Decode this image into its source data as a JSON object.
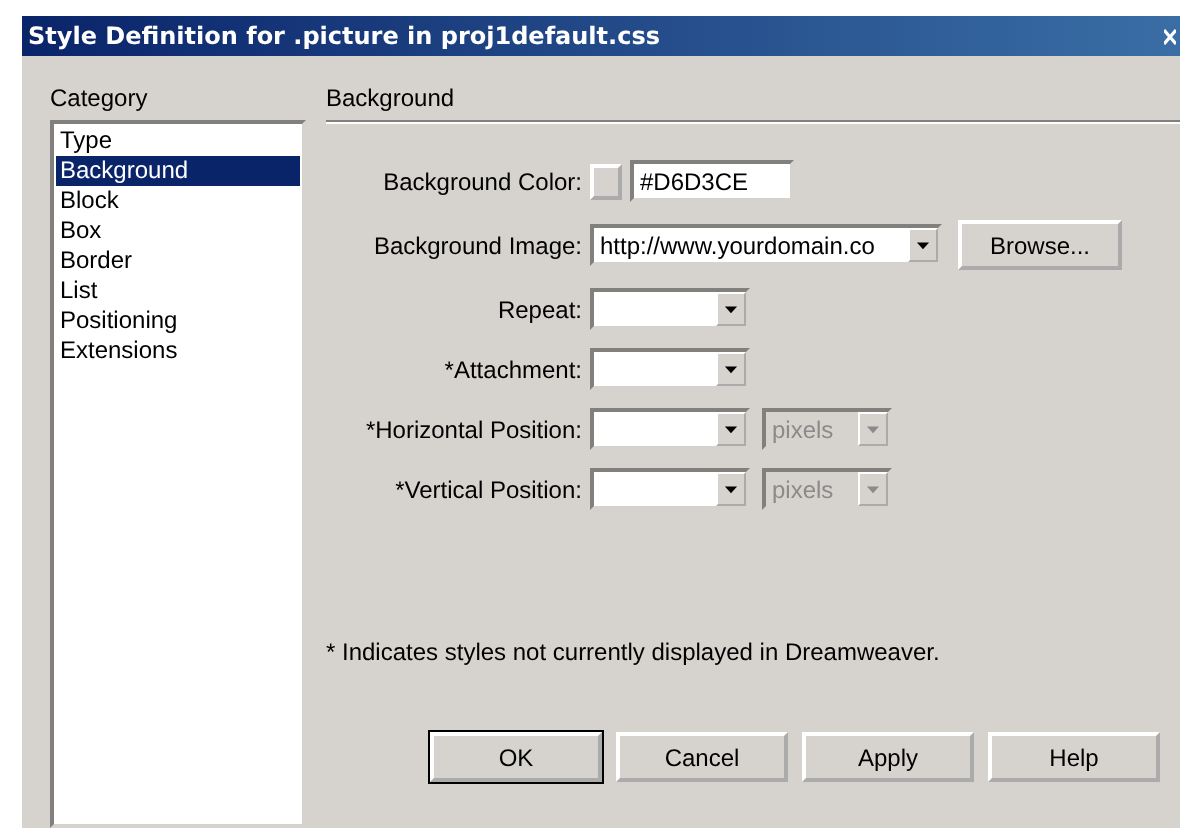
{
  "window": {
    "title": "Style Definition for .picture in proj1default.css"
  },
  "category": {
    "label": "Category",
    "items": [
      {
        "label": "Type",
        "selected": false
      },
      {
        "label": "Background",
        "selected": true
      },
      {
        "label": "Block",
        "selected": false
      },
      {
        "label": "Box",
        "selected": false
      },
      {
        "label": "Border",
        "selected": false
      },
      {
        "label": "List",
        "selected": false
      },
      {
        "label": "Positioning",
        "selected": false
      },
      {
        "label": "Extensions",
        "selected": false
      }
    ]
  },
  "panel": {
    "heading": "Background",
    "fields": [
      {
        "kind": "color",
        "label": "Background Color:",
        "value": "#D6D3CE"
      },
      {
        "kind": "image",
        "label": "Background Image:",
        "value": "http://www.yourdomain.co",
        "button": "Browse..."
      },
      {
        "kind": "select",
        "label": "Repeat:"
      },
      {
        "kind": "select",
        "label": "*Attachment:"
      },
      {
        "kind": "position",
        "label": "*Horizontal Position:",
        "unit": "pixels",
        "unit_disabled": true
      },
      {
        "kind": "position",
        "label": "*Vertical Position:",
        "unit": "pixels",
        "unit_disabled": true
      }
    ],
    "note": "* Indicates styles not currently displayed in Dreamweaver."
  },
  "buttons": [
    {
      "label": "OK",
      "default": true
    },
    {
      "label": "Cancel",
      "default": false
    },
    {
      "label": "Apply",
      "default": false
    },
    {
      "label": "Help",
      "default": false
    }
  ]
}
